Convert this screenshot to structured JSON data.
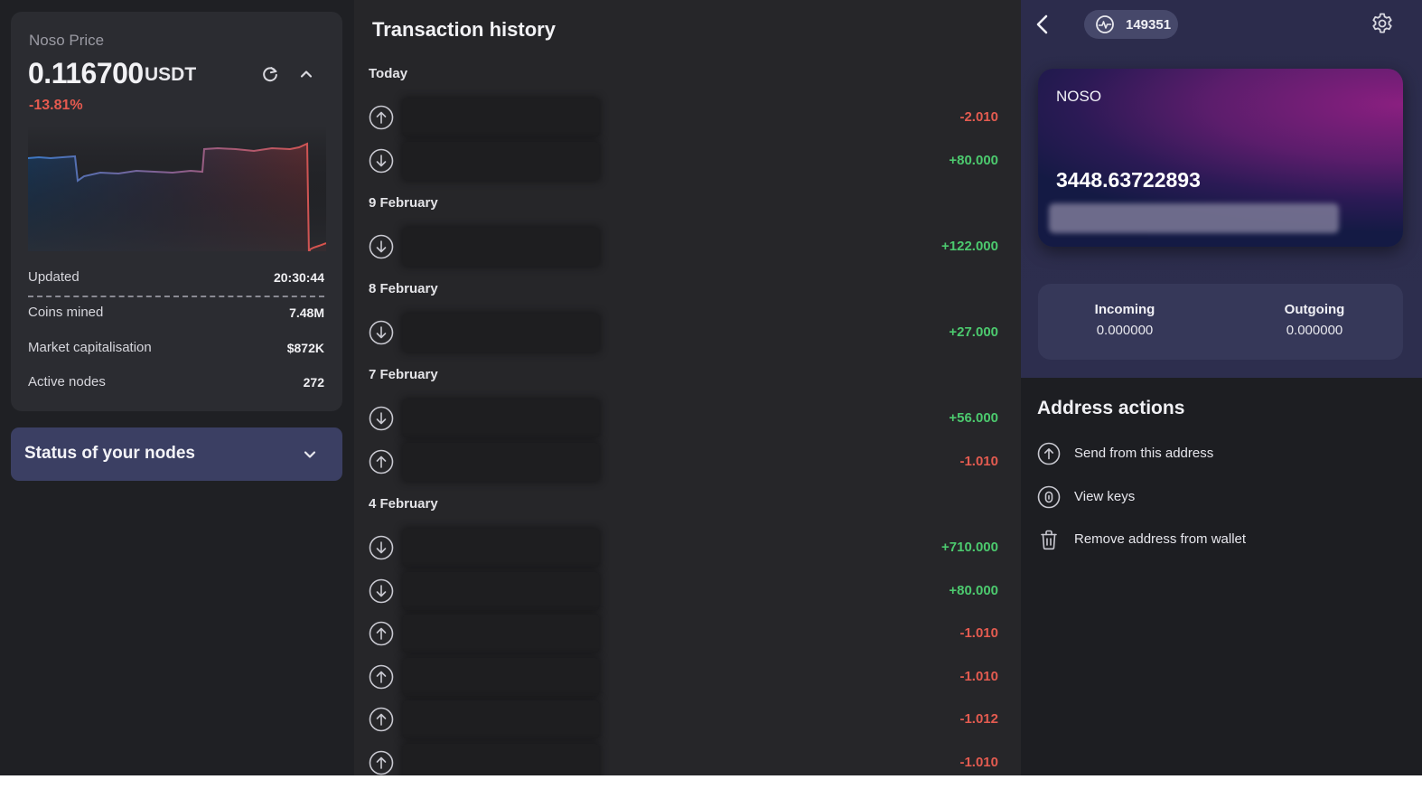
{
  "price_panel": {
    "title": "Noso Price",
    "price": "0.116700",
    "unit": "USDT",
    "change": "-13.81%",
    "icons": {
      "refresh": "refresh-icon",
      "collapse": "chevron-up-icon"
    },
    "stats": [
      {
        "label": "Updated",
        "value": "20:30:44"
      },
      {
        "label": "Coins mined",
        "value": "7.48M"
      },
      {
        "label": "Market capitalisation",
        "value": "$872K"
      },
      {
        "label": "Active nodes",
        "value": "272"
      }
    ]
  },
  "nodes_panel": {
    "title": "Status of your nodes",
    "icon": "chevron-down-icon"
  },
  "transactions": {
    "title": "Transaction history",
    "groups": [
      {
        "label": "Today",
        "items": [
          {
            "direction": "out",
            "amount": "-2.010"
          },
          {
            "direction": "in",
            "amount": "+80.000"
          }
        ]
      },
      {
        "label": "9 February",
        "items": [
          {
            "direction": "in",
            "amount": "+122.000"
          }
        ]
      },
      {
        "label": "8 February",
        "items": [
          {
            "direction": "in",
            "amount": "+27.000"
          }
        ]
      },
      {
        "label": "7 February",
        "items": [
          {
            "direction": "in",
            "amount": "+56.000"
          },
          {
            "direction": "out",
            "amount": "-1.010"
          }
        ]
      },
      {
        "label": "4 February",
        "items": [
          {
            "direction": "in",
            "amount": "+710.000"
          },
          {
            "direction": "in",
            "amount": "+80.000"
          },
          {
            "direction": "out",
            "amount": "-1.010"
          },
          {
            "direction": "out",
            "amount": "-1.010"
          },
          {
            "direction": "out",
            "amount": "-1.012"
          },
          {
            "direction": "out",
            "amount": "-1.010"
          }
        ]
      }
    ]
  },
  "wallet": {
    "block_number": "149351",
    "card_name": "NOSO",
    "balance": "3448.63722893",
    "incoming_label": "Incoming",
    "incoming_value": "0.000000",
    "outgoing_label": "Outgoing",
    "outgoing_value": "0.000000",
    "icons": {
      "back": "chevron-left-icon",
      "block": "activity-icon",
      "settings": "gear-icon"
    }
  },
  "address_actions": {
    "title": "Address actions",
    "items": [
      {
        "label": "Send from this address",
        "icon": "send-up-icon"
      },
      {
        "label": "View keys",
        "icon": "key-icon"
      },
      {
        "label": "Remove address from wallet",
        "icon": "trash-icon"
      }
    ]
  },
  "colors": {
    "negative": "#e35b50",
    "positive": "#4cc96e",
    "nodes_card": "#3b3f63",
    "panel": "#2b2c31"
  }
}
